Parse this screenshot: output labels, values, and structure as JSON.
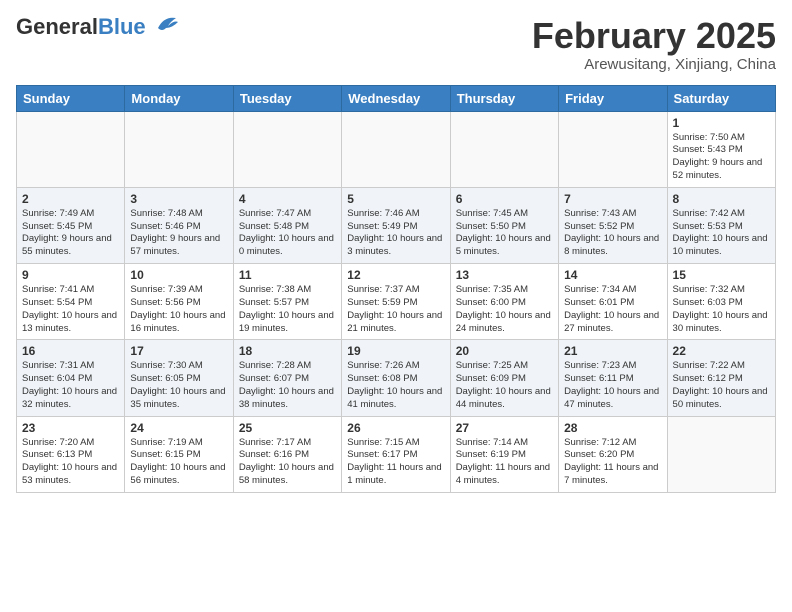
{
  "header": {
    "logo_general": "General",
    "logo_blue": "Blue",
    "month_title": "February 2025",
    "location": "Arewusitang, Xinjiang, China"
  },
  "days_of_week": [
    "Sunday",
    "Monday",
    "Tuesday",
    "Wednesday",
    "Thursday",
    "Friday",
    "Saturday"
  ],
  "weeks": [
    [
      {
        "day": "",
        "info": ""
      },
      {
        "day": "",
        "info": ""
      },
      {
        "day": "",
        "info": ""
      },
      {
        "day": "",
        "info": ""
      },
      {
        "day": "",
        "info": ""
      },
      {
        "day": "",
        "info": ""
      },
      {
        "day": "1",
        "info": "Sunrise: 7:50 AM\nSunset: 5:43 PM\nDaylight: 9 hours and 52 minutes."
      }
    ],
    [
      {
        "day": "2",
        "info": "Sunrise: 7:49 AM\nSunset: 5:45 PM\nDaylight: 9 hours and 55 minutes."
      },
      {
        "day": "3",
        "info": "Sunrise: 7:48 AM\nSunset: 5:46 PM\nDaylight: 9 hours and 57 minutes."
      },
      {
        "day": "4",
        "info": "Sunrise: 7:47 AM\nSunset: 5:48 PM\nDaylight: 10 hours and 0 minutes."
      },
      {
        "day": "5",
        "info": "Sunrise: 7:46 AM\nSunset: 5:49 PM\nDaylight: 10 hours and 3 minutes."
      },
      {
        "day": "6",
        "info": "Sunrise: 7:45 AM\nSunset: 5:50 PM\nDaylight: 10 hours and 5 minutes."
      },
      {
        "day": "7",
        "info": "Sunrise: 7:43 AM\nSunset: 5:52 PM\nDaylight: 10 hours and 8 minutes."
      },
      {
        "day": "8",
        "info": "Sunrise: 7:42 AM\nSunset: 5:53 PM\nDaylight: 10 hours and 10 minutes."
      }
    ],
    [
      {
        "day": "9",
        "info": "Sunrise: 7:41 AM\nSunset: 5:54 PM\nDaylight: 10 hours and 13 minutes."
      },
      {
        "day": "10",
        "info": "Sunrise: 7:39 AM\nSunset: 5:56 PM\nDaylight: 10 hours and 16 minutes."
      },
      {
        "day": "11",
        "info": "Sunrise: 7:38 AM\nSunset: 5:57 PM\nDaylight: 10 hours and 19 minutes."
      },
      {
        "day": "12",
        "info": "Sunrise: 7:37 AM\nSunset: 5:59 PM\nDaylight: 10 hours and 21 minutes."
      },
      {
        "day": "13",
        "info": "Sunrise: 7:35 AM\nSunset: 6:00 PM\nDaylight: 10 hours and 24 minutes."
      },
      {
        "day": "14",
        "info": "Sunrise: 7:34 AM\nSunset: 6:01 PM\nDaylight: 10 hours and 27 minutes."
      },
      {
        "day": "15",
        "info": "Sunrise: 7:32 AM\nSunset: 6:03 PM\nDaylight: 10 hours and 30 minutes."
      }
    ],
    [
      {
        "day": "16",
        "info": "Sunrise: 7:31 AM\nSunset: 6:04 PM\nDaylight: 10 hours and 32 minutes."
      },
      {
        "day": "17",
        "info": "Sunrise: 7:30 AM\nSunset: 6:05 PM\nDaylight: 10 hours and 35 minutes."
      },
      {
        "day": "18",
        "info": "Sunrise: 7:28 AM\nSunset: 6:07 PM\nDaylight: 10 hours and 38 minutes."
      },
      {
        "day": "19",
        "info": "Sunrise: 7:26 AM\nSunset: 6:08 PM\nDaylight: 10 hours and 41 minutes."
      },
      {
        "day": "20",
        "info": "Sunrise: 7:25 AM\nSunset: 6:09 PM\nDaylight: 10 hours and 44 minutes."
      },
      {
        "day": "21",
        "info": "Sunrise: 7:23 AM\nSunset: 6:11 PM\nDaylight: 10 hours and 47 minutes."
      },
      {
        "day": "22",
        "info": "Sunrise: 7:22 AM\nSunset: 6:12 PM\nDaylight: 10 hours and 50 minutes."
      }
    ],
    [
      {
        "day": "23",
        "info": "Sunrise: 7:20 AM\nSunset: 6:13 PM\nDaylight: 10 hours and 53 minutes."
      },
      {
        "day": "24",
        "info": "Sunrise: 7:19 AM\nSunset: 6:15 PM\nDaylight: 10 hours and 56 minutes."
      },
      {
        "day": "25",
        "info": "Sunrise: 7:17 AM\nSunset: 6:16 PM\nDaylight: 10 hours and 58 minutes."
      },
      {
        "day": "26",
        "info": "Sunrise: 7:15 AM\nSunset: 6:17 PM\nDaylight: 11 hours and 1 minute."
      },
      {
        "day": "27",
        "info": "Sunrise: 7:14 AM\nSunset: 6:19 PM\nDaylight: 11 hours and 4 minutes."
      },
      {
        "day": "28",
        "info": "Sunrise: 7:12 AM\nSunset: 6:20 PM\nDaylight: 11 hours and 7 minutes."
      },
      {
        "day": "",
        "info": ""
      }
    ]
  ]
}
